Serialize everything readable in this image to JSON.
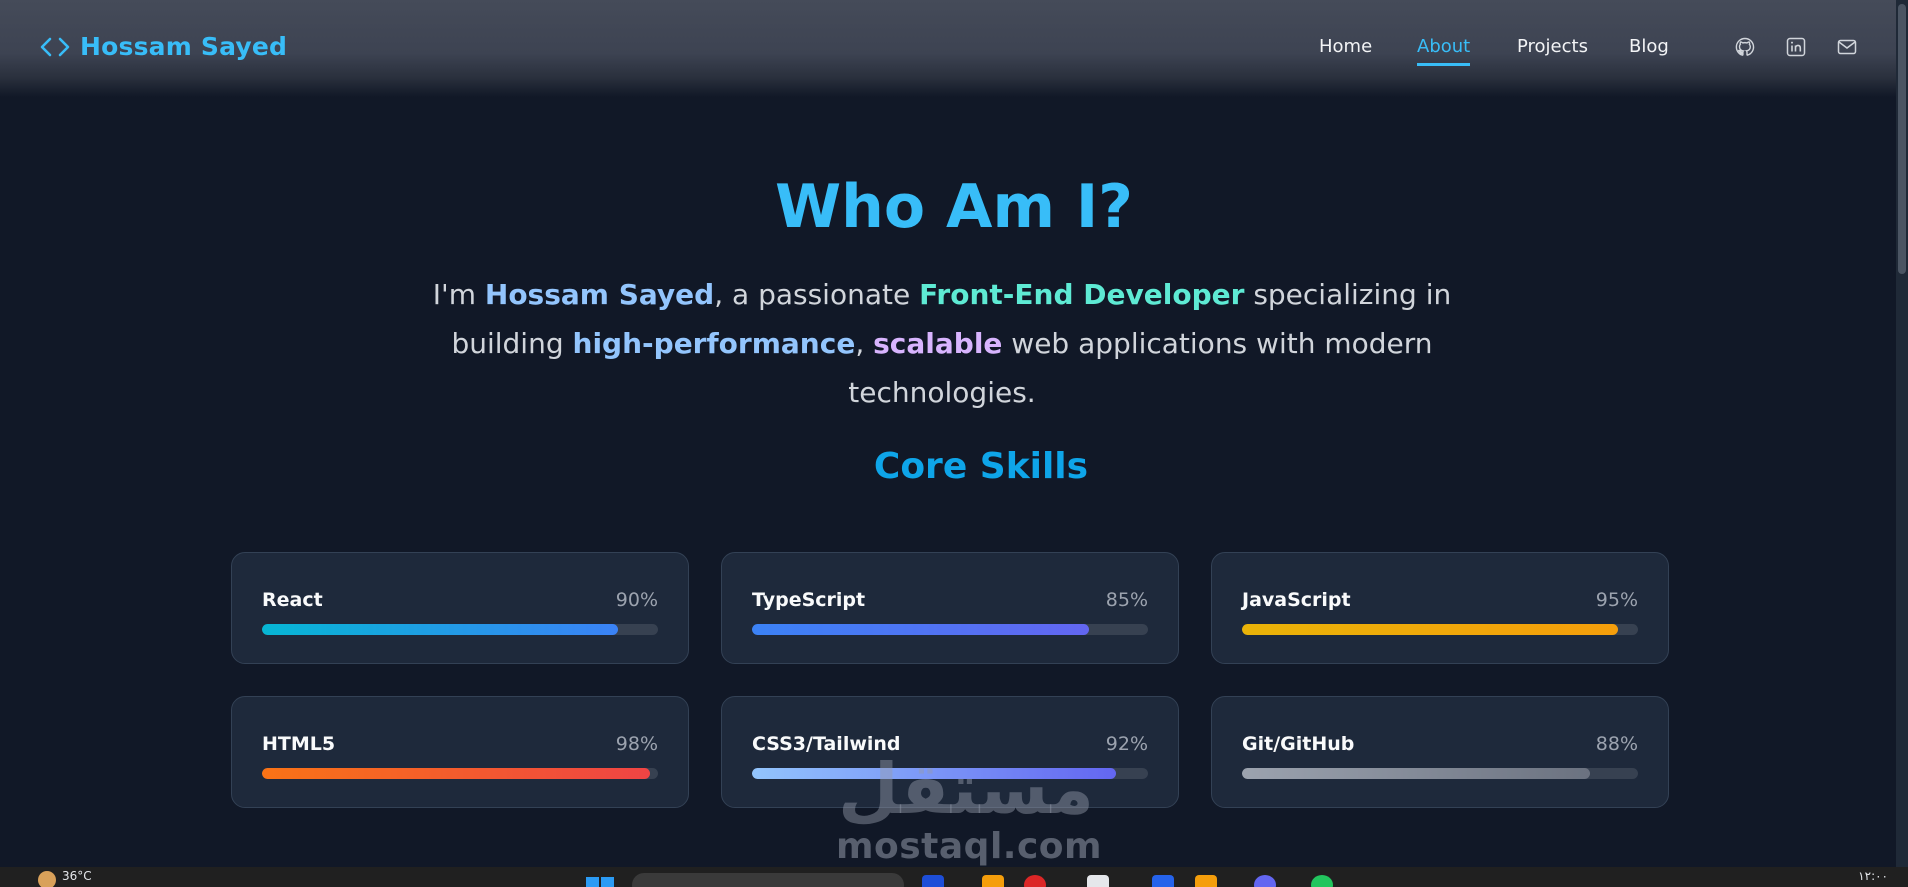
{
  "brand": {
    "name": "Hossam Sayed",
    "icon": "code-brackets-icon"
  },
  "nav": {
    "items": [
      {
        "label": "Home",
        "active": false
      },
      {
        "label": "About",
        "active": true
      },
      {
        "label": "Projects",
        "active": false
      },
      {
        "label": "Blog",
        "active": false
      }
    ],
    "social": [
      "github-icon",
      "linkedin-icon",
      "mail-icon"
    ]
  },
  "hero": {
    "title": "Who Am I?",
    "intro": {
      "p1": "I'm ",
      "name": "Hossam Sayed",
      "p2": ", a passionate ",
      "role": "Front-End Developer",
      "p3": " specializing in building ",
      "quality1": "high-performance",
      "p4": ", ",
      "quality2": "scalable",
      "p5": " web applications with modern technologies."
    }
  },
  "skills": {
    "title": "Core Skills",
    "items": [
      {
        "name": "React",
        "percent": "90%",
        "level": 0.9,
        "gradient": [
          "#06b6d4",
          "#3b82f6"
        ]
      },
      {
        "name": "TypeScript",
        "percent": "85%",
        "level": 0.85,
        "gradient": [
          "#3b82f6",
          "#6366f1"
        ]
      },
      {
        "name": "JavaScript",
        "percent": "95%",
        "level": 0.95,
        "gradient": [
          "#eab308",
          "#f59e0b"
        ]
      },
      {
        "name": "HTML5",
        "percent": "98%",
        "level": 0.98,
        "gradient": [
          "#f97316",
          "#ef4444"
        ]
      },
      {
        "name": "CSS3/Tailwind",
        "percent": "92%",
        "level": 0.92,
        "gradient": [
          "#93c5fd",
          "#6366f1"
        ]
      },
      {
        "name": "Git/GitHub",
        "percent": "88%",
        "level": 0.88,
        "gradient": [
          "#9ca3af",
          "#6b7280"
        ]
      }
    ]
  },
  "watermark": {
    "arabic": "مستقل",
    "text": "mostaql.com"
  },
  "taskbar": {
    "weather": "36°C",
    "clock": "١٢:٠٠"
  },
  "colors": {
    "accent": "#38bdf8",
    "background": "#111827",
    "card": "#1e293b"
  }
}
